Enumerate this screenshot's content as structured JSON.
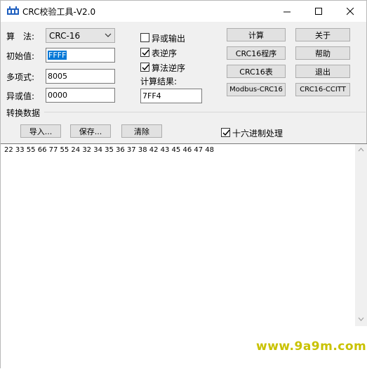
{
  "window": {
    "title": "CRC校验工具-V2.0",
    "controls": [
      "minimize",
      "maximize",
      "close"
    ]
  },
  "params": {
    "algorithm_label": "算　法:",
    "algorithm_value": "CRC-16",
    "init_label": "初始值:",
    "init_value": "FFFF",
    "poly_label": "多项式:",
    "poly_value": "8005",
    "xor_label": "异或值:",
    "xor_value": "0000"
  },
  "options": {
    "xor_output": {
      "label": "异或输出",
      "checked": false
    },
    "table_reverse": {
      "label": "表逆序",
      "checked": true
    },
    "algo_reverse": {
      "label": "算法逆序",
      "checked": true
    },
    "result_label": "计算结果:",
    "result_value": "7FF4"
  },
  "buttons": {
    "calculate": "计算",
    "about": "关于",
    "crc16_program": "CRC16程序",
    "help": "帮助",
    "crc16_table": "CRC16表",
    "exit": "退出",
    "modbus_crc16": "Modbus-CRC16",
    "crc16_ccitt": "CRC16-CCITT"
  },
  "convert": {
    "group_label": "转换数据",
    "import": "导入...",
    "save": "保存...",
    "clear": "清除",
    "hex_mode": {
      "label": "十六进制处理",
      "checked": true
    },
    "data": "22 33 55 66 77 55 24 32 34 35 36 37 38 42 43 45 46 47 48"
  },
  "watermark": "www.9a9m.com",
  "colors": {
    "selection": "#0078d7",
    "button_face": "#e1e1e1",
    "window_bg": "#f0f0f0",
    "watermark": "#c9c200"
  }
}
